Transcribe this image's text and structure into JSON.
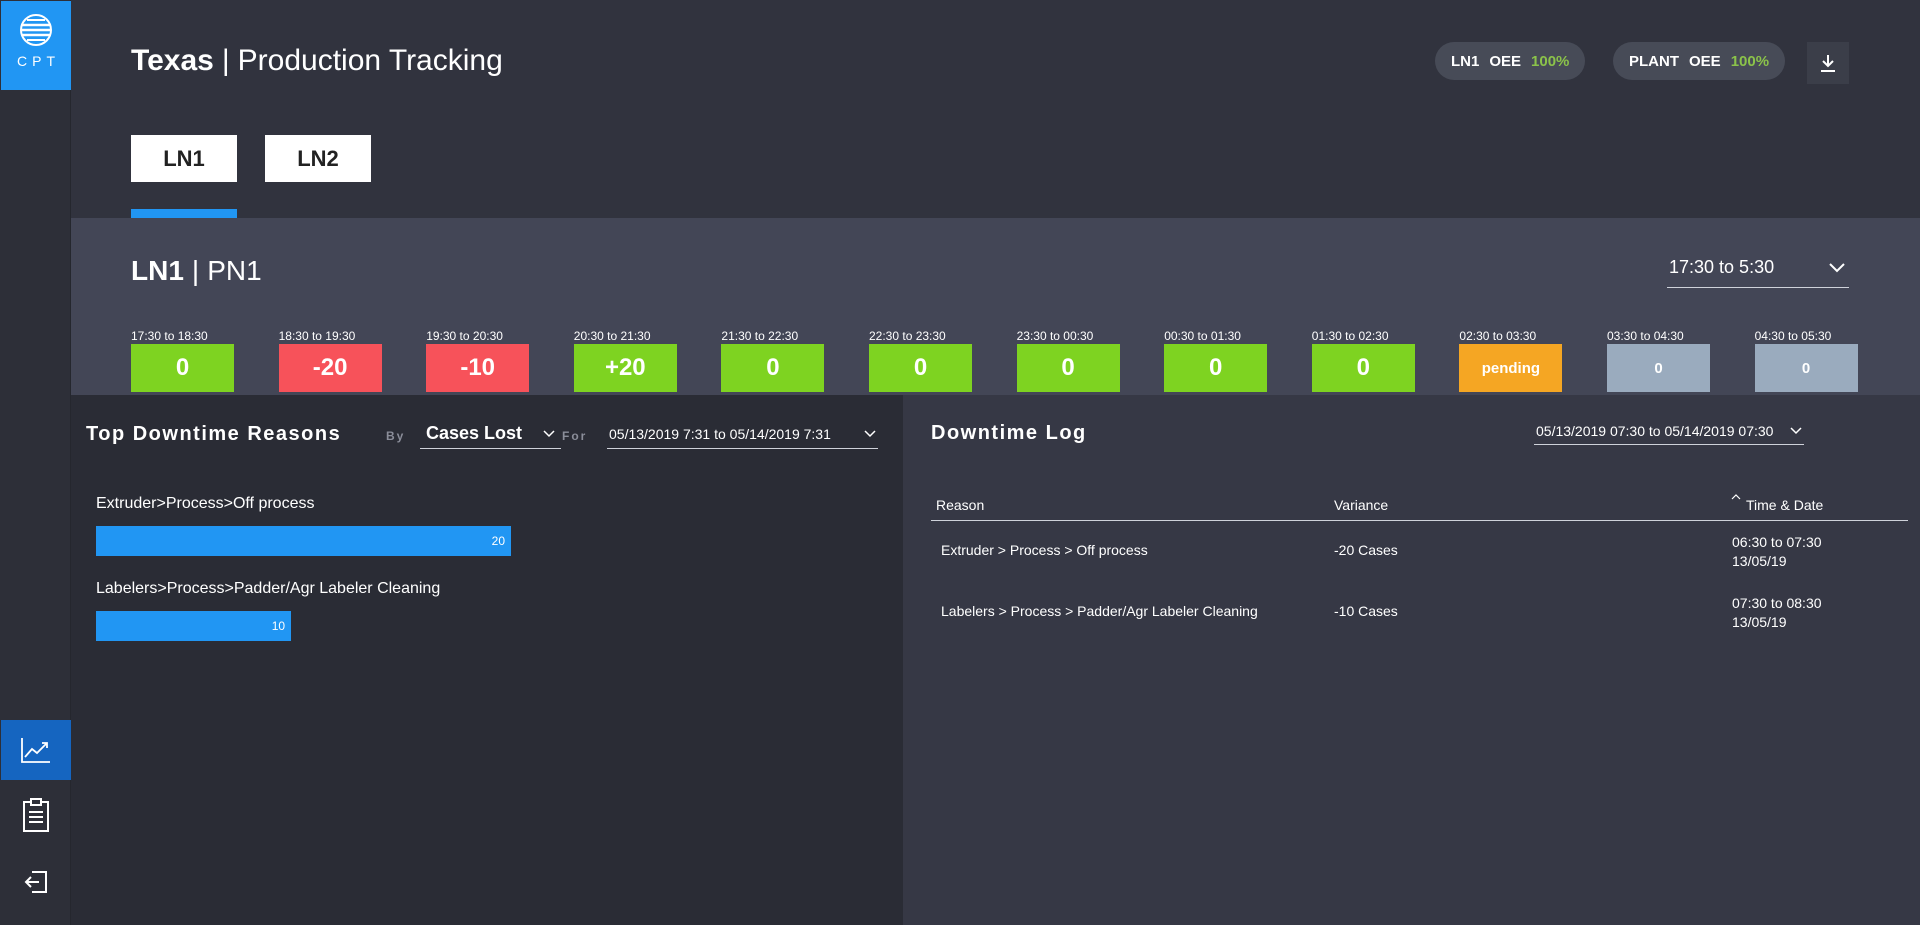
{
  "logo": {
    "text": "CPT"
  },
  "header": {
    "site": "Texas",
    "separator": "|",
    "subtitle": "Production Tracking",
    "oee_pills": [
      {
        "label": "LN1",
        "metric": "OEE",
        "value": "100%"
      },
      {
        "label": "PLANT",
        "metric": "OEE",
        "value": "100%"
      }
    ]
  },
  "tabs": [
    {
      "label": "LN1",
      "active": true
    },
    {
      "label": "LN2",
      "active": false
    }
  ],
  "line": {
    "name": "LN1",
    "separator": "|",
    "product": "PN1",
    "shift": "17:30 to 5:30"
  },
  "hours": [
    {
      "label": "17:30 to 18:30",
      "value": "0",
      "status": "good"
    },
    {
      "label": "18:30 to 19:30",
      "value": "-20",
      "status": "bad"
    },
    {
      "label": "19:30 to 20:30",
      "value": "-10",
      "status": "bad"
    },
    {
      "label": "20:30 to 21:30",
      "value": "+20",
      "status": "good"
    },
    {
      "label": "21:30 to 22:30",
      "value": "0",
      "status": "good"
    },
    {
      "label": "22:30 to 23:30",
      "value": "0",
      "status": "good"
    },
    {
      "label": "23:30 to 00:30",
      "value": "0",
      "status": "good"
    },
    {
      "label": "00:30 to 01:30",
      "value": "0",
      "status": "good"
    },
    {
      "label": "01:30 to 02:30",
      "value": "0",
      "status": "good"
    },
    {
      "label": "02:30 to 03:30",
      "value": "pending",
      "status": "pending"
    },
    {
      "label": "03:30 to 04:30",
      "value": "0",
      "status": "future"
    },
    {
      "label": "04:30 to 05:30",
      "value": "0",
      "status": "future"
    }
  ],
  "downtime_reasons": {
    "title": "Top Downtime Reasons",
    "by_label": "By",
    "by_value": "Cases Lost",
    "for_label": "For",
    "range": "05/13/2019 7:31 to 05/14/2019 7:31",
    "items": [
      {
        "label": "Extruder>Process>Off process",
        "value": 20
      },
      {
        "label": "Labelers>Process>Padder/Agr Labeler Cleaning",
        "value": 10
      }
    ],
    "item_value_texts": [
      "20",
      "10"
    ]
  },
  "downtime_log": {
    "title": "Downtime Log",
    "range": "05/13/2019 07:30 to 05/14/2019 07:30",
    "columns": {
      "reason": "Reason",
      "variance": "Variance",
      "time": "Time & Date"
    },
    "rows": [
      {
        "reason": "Extruder > Process > Off process",
        "variance": "-20 Cases",
        "time": "06:30 to 07:30",
        "date": "13/05/19"
      },
      {
        "reason": "Labelers > Process > Padder/Agr Labeler Cleaning",
        "variance": "-10 Cases",
        "time": "07:30 to 08:30",
        "date": "13/05/19"
      }
    ]
  },
  "colors": {
    "accent": "#2196f3",
    "good": "#7ed321",
    "bad": "#f7525a",
    "pending": "#f5a623",
    "future": "#9aabbe",
    "oee": "#8bc34a"
  }
}
